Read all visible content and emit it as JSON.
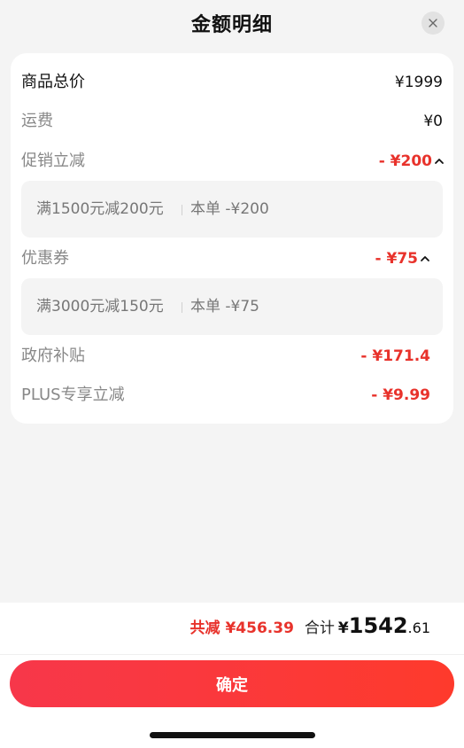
{
  "header": {
    "title": "金额明细",
    "close_icon": "close-icon"
  },
  "details": {
    "goods_total": {
      "label": "商品总价",
      "value": "¥1999"
    },
    "shipping": {
      "label": "运费",
      "value": "¥0"
    },
    "promotion": {
      "label": "促销立减",
      "value": "- ¥200",
      "expanded": true,
      "rule": "满1500元减200元",
      "order_discount": "本单 -¥200"
    },
    "coupon": {
      "label": "优惠券",
      "value": "- ¥75",
      "rule": "满3000元减150元",
      "order_discount": "本单 -¥75"
    },
    "gov_subsidy": {
      "label": "政府补贴",
      "value": "- ¥171.4"
    },
    "plus_discount": {
      "label": "PLUS专享立减",
      "value": "- ¥9.99"
    }
  },
  "summary": {
    "saved_label": "共减",
    "saved_value": "¥456.39",
    "total_label": "合计",
    "total_currency": "¥",
    "total_integer": "1542",
    "total_decimal": ".61"
  },
  "confirm_label": "确定",
  "colors": {
    "accent": "#e8322b",
    "button_start": "#f7374a",
    "button_end": "#fe3a2c"
  }
}
